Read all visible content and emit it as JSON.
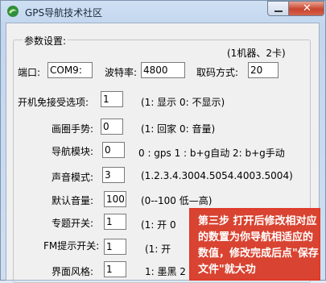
{
  "window": {
    "title": "GPS导航技术社区",
    "close_label": "✕"
  },
  "group": {
    "label": "参数设置:",
    "note": "(1机器、2卡)"
  },
  "fields": [
    {
      "label": "端口:",
      "value": "COM9:"
    },
    {
      "label": "波特率:",
      "value": "4800"
    },
    {
      "label": "取码方式:",
      "value": "20"
    },
    {
      "label": "开机免接受选项:",
      "value": "1",
      "hint": "(1: 显示 0: 不显示)"
    },
    {
      "label": "画圈手势:",
      "value": "0",
      "hint": "(1: 回家 0: 音量)"
    },
    {
      "label": "导航模块:",
      "value": "0",
      "hint": "0 : gps  1 : b+g自动  2: b+g手动"
    },
    {
      "label": "声音模式:",
      "value": "3",
      "hint": "(1.2.3.4.3004.5054.4003.5004)"
    },
    {
      "label": "默认音量:",
      "value": "100",
      "hint": "(0--100 低—高)"
    },
    {
      "label": "专题开关:",
      "value": "1",
      "hint": "(1: 开 0"
    },
    {
      "label": "FM提示开关:",
      "value": "1",
      "hint": "(1: 开"
    },
    {
      "label": "界面风格:",
      "value": "1",
      "hint": "1: 墨黑  2"
    }
  ],
  "callout": {
    "text": "第三步 打开后修改相对应的数置为你导航相适应的数值，修改完成后点\"保存文件\"就大功"
  },
  "colors": {
    "callout_red": "#d94331",
    "title_bg": "#c8d9ef"
  }
}
